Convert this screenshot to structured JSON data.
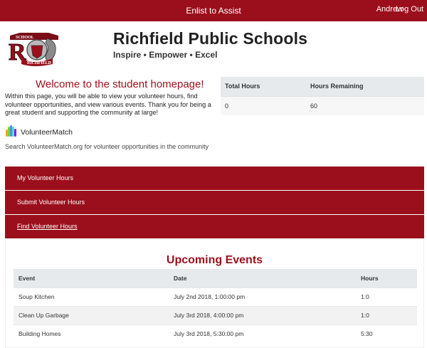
{
  "topbar": {
    "brand": "Enlist to Assist",
    "user": "Andrew",
    "logout": "Log Out"
  },
  "header": {
    "school_name": "Richfield Public Schools",
    "motto": "Inspire • Empower • Excel",
    "logo_label": "RICHFIELD"
  },
  "welcome": {
    "title": "Welcome to the student homepage!",
    "intro": "Within this page, you will be able to view your volunteer hours, find volunteer opportunities, and view various events. Thank you for being a great student and supporting the community at large!"
  },
  "volunteermatch": {
    "label": "VolunteerMatch",
    "search_text": "Search VolunteerMatch.org for volunteer opportunities in the community"
  },
  "hours": {
    "headers": [
      "Total Hours",
      "Hours Remaining"
    ],
    "values": [
      "0",
      "60"
    ]
  },
  "nav": {
    "my_hours": "My Volunteer Hours",
    "submit_hours": "Submit Volunteer Hours",
    "find_hours": "Find Volunteer Hours"
  },
  "events": {
    "title": "Upcoming Events",
    "headers": [
      "Event",
      "Date",
      "Hours"
    ],
    "rows": [
      [
        "Soup Kitchen",
        "July 2nd 2018, 1:00:00 pm",
        "1:0"
      ],
      [
        "Clean Up Garbage",
        "July 3rd 2018, 4:00:00 pm",
        "1:0"
      ],
      [
        "Building Homes",
        "July 3rd 2018, 5:30:00 pm",
        "5:30"
      ]
    ]
  },
  "colors": {
    "brand": "#9b0f1c",
    "table_header": "#e6eaed"
  }
}
